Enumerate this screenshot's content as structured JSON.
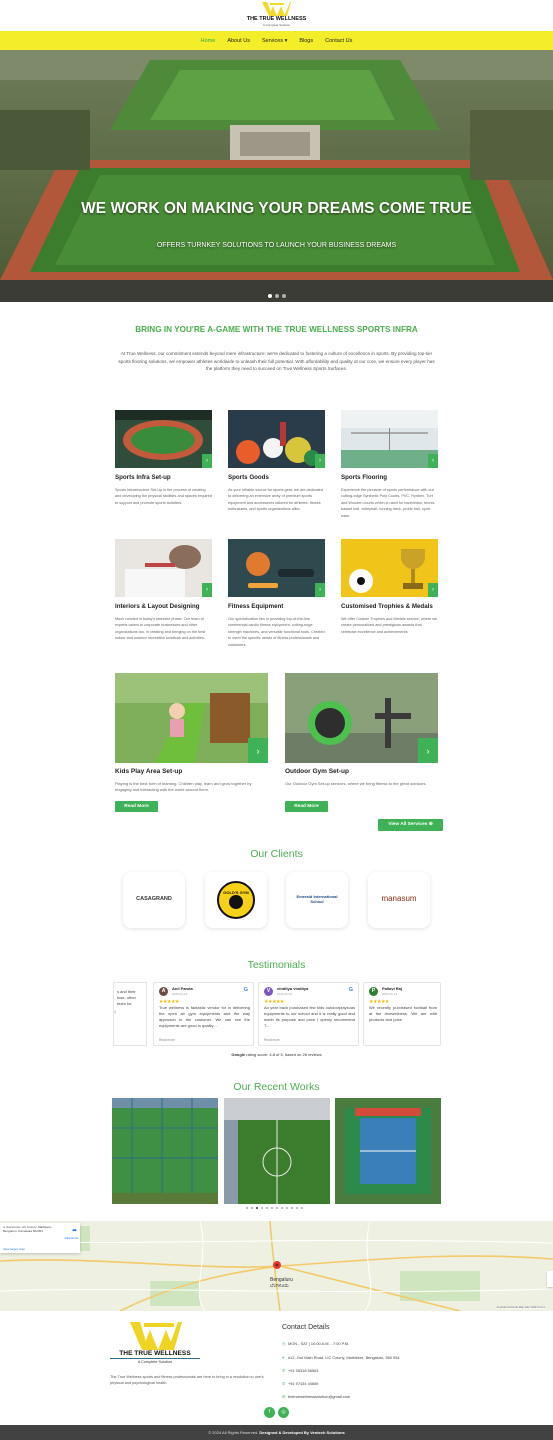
{
  "header": {
    "logo_title": "THE TRUE WELLNESS",
    "logo_subtitle": "A Complete Solution",
    "brand_yellow": "#f3ee29",
    "brand_green": "#3fb257"
  },
  "nav": {
    "items": [
      "Home",
      "About Us",
      "Services ▾",
      "Blogs",
      "Contact Us"
    ],
    "active": "Home"
  },
  "hero": {
    "title": "WE WORK ON MAKING YOUR DREAMS COME TRUE",
    "subtitle": "OFFERS TURNKEY SOLUTIONS TO LAUNCH YOUR BUSINESS DREAMS"
  },
  "intro": {
    "heading": "BRING IN YOU'RE A-GAME WITH THE TRUE WELLNESS SPORTS INFRA",
    "text": "At True Wellness, our commitment extends beyond mere infrastructure; we're dedicated to fostering a culture of excellence in sports. By providing top-tier sports flooring solutions, we empower athletes worldwide to unleash their full potential. With affordability and quality at our core, we ensure every player has the platform they need to succeed on True Wellness Sports Surfaces."
  },
  "services": [
    {
      "title": "Sports Infra Set-up",
      "text": "Sports Infrastructure Set-Up is the process of creating and developing the physical facilities and spaces required to support and promote sports activities.",
      "arrow": "›",
      "icon": "photo-stadium"
    },
    {
      "title": "Sports Goods",
      "text": "As your reliable source for sports gear, we are dedicated to delivering an extensive array of premium sports equipment and accessories tailored for athletes, fitness enthusiasts, and sports organizations alike.",
      "arrow": "›",
      "icon": "photo-sports-goods"
    },
    {
      "title": "Sports Flooring",
      "text": "Experience the pinnacle of sports performance with our cutting-edge Synthetic Poly Courts, PVC, Rynbex, Turf and Wooden courts which is used for badminton, tennis, basket ball, volleyball, running track, pickle ball, cycle track.",
      "arrow": "›",
      "icon": "photo-indoor-court"
    },
    {
      "title": "Interiors & Layout Designing",
      "text": "Much needed in today's stressful phase. Our team of experts caters to corporate businesses and other organizations too, in creating and bringing on the best indoor and outdoor recreation solutions and activities.",
      "arrow": "›",
      "icon": "photo-designing"
    },
    {
      "title": "Fitness Equipment",
      "text": "Our specialization lies in providing top-of-the-line commercial cardio fitness equipment, cutting-edge strength machines, and versatile functional tools. Created to meet the specific needs of fitness professionals and customers.",
      "arrow": "›",
      "icon": "photo-fitness"
    },
    {
      "title": "Customised Trophies & Medals",
      "text": "We offer Custom Trophies and Medals service, where we create personalized and prestigious awards that celebrate excellence and achievements.",
      "arrow": "›",
      "icon": "photo-trophies"
    }
  ],
  "services_wide": [
    {
      "title": "Kids Play Area Set-up",
      "text": "Playing is the best form of learning. Children play, learn and grow together by engaging and interacting with the world around them.",
      "button": "Read More",
      "arrow": "›"
    },
    {
      "title": "Outdoor Gym Set-up",
      "text": "Our Outdoor Gym Set-up services, where we bring fitness to the great outdoors.",
      "button": "Read More",
      "arrow": "›"
    }
  ],
  "view_all": "View All Services ⊕",
  "clients": {
    "heading": "Our Clients",
    "logos": [
      "CASAGRAND",
      "GOLD'S GYM",
      "Emerald International School",
      "manasum"
    ]
  },
  "testimonials": {
    "heading": "Testimonials",
    "partial_left": "s and their fuse, other team for",
    "reviews": [
      {
        "initial": "A",
        "name": "Anil Panda",
        "date": "2023-01-13",
        "stars": "★★★★★",
        "text": "True wellness is fantastic vendor for in delivering the open air gym equipments and the way approach to the customer. We can see the equipments are good in quality....",
        "more": "Read more",
        "color": "#6d4c41"
      },
      {
        "initial": "V",
        "name": "vinditya vinditya",
        "date": "2023-11-07",
        "stars": "★★★★★",
        "text": "An year back purchased few kids outdoorplaysoas equipments to our school and it is really good and worth its purpose and price I openly recommend T...",
        "more": "Read more",
        "color": "#7e57c2"
      },
      {
        "initial": "P",
        "name": "Pallavi Raj",
        "date": "2023-11-14",
        "stars": "★★★★★",
        "text": "We recently purchased football from at the truewellness. We are with products and price",
        "more": "",
        "color": "#2e7d32"
      }
    ],
    "summary_prefix": "Google",
    "summary_text": "rating score: 4.8 of 5, based on 26 reviews"
  },
  "works": {
    "heading": "Our Recent Works"
  },
  "map": {
    "city": "Bengaluru",
    "city_local": "ಬೆಂಗಳೂರು",
    "card_text": "4, 2nd Cross, LIC Colony, Mathikere, Bengaluru, Karnataka 560054",
    "card_link": "View larger map",
    "directions": "Directions",
    "credit": "Keyboard shortcuts   Map data ©2024   Terms"
  },
  "footer": {
    "logo_title": "THE TRUE WELLNESS",
    "logo_subtitle": "A Complete Solution",
    "blurb": "The True Wellness sports and fitness professionals are here to bring in a revolution to one's physical and psychological health.",
    "contact_heading": "Contact Details",
    "contacts": [
      {
        "icon": "clock-icon",
        "glyph": "◷",
        "text": "MON - SAT | 10:00 A.M. - 7:00 P.M."
      },
      {
        "icon": "pin-icon",
        "glyph": "⌖",
        "text": "#12, 2nd Main Road, LIC Colony, Mathikere, Bengaluru, 560 054"
      },
      {
        "icon": "phone-icon",
        "glyph": "✆",
        "text": "+91 95318 56563"
      },
      {
        "icon": "phone-icon",
        "glyph": "✆",
        "text": "+91 97434 44689"
      },
      {
        "icon": "mail-icon",
        "glyph": "✉",
        "text": "thetruewellnesssolution@gmail.com"
      }
    ],
    "social": [
      "f",
      "◎"
    ],
    "copyright": "© 2024 All Rights Reserved.",
    "credit": "Designed & Developed By Ventech Solutions"
  }
}
